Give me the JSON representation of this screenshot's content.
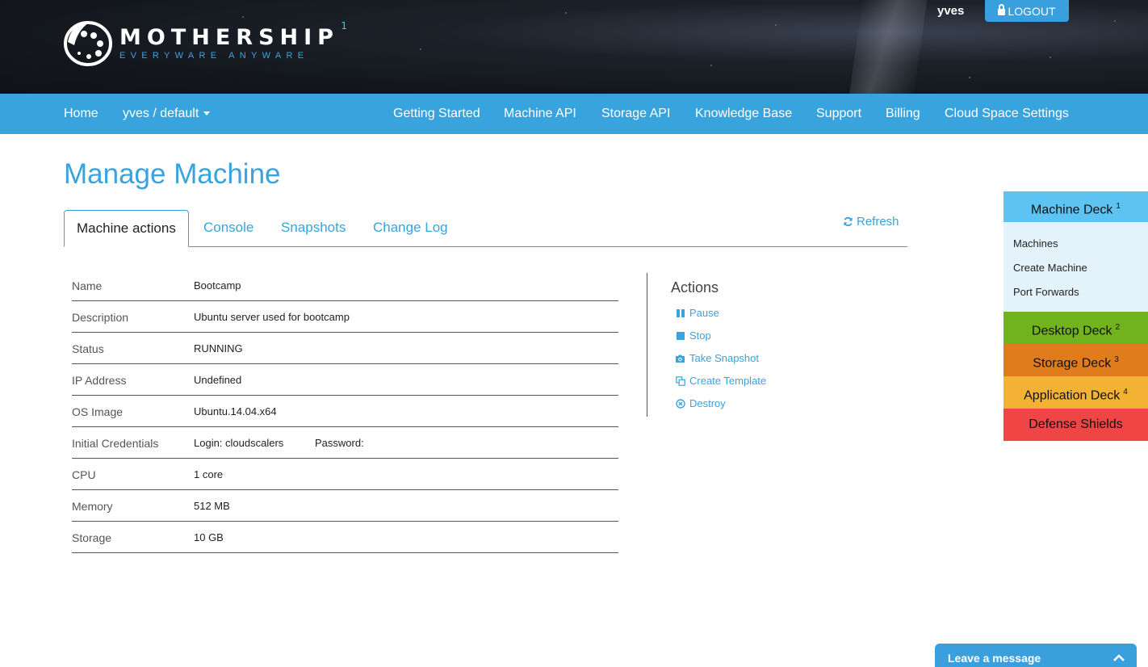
{
  "header": {
    "brand_name": "MOTHERSHIP",
    "brand_sup": "1",
    "brand_tagline": "EVERYWARE ANYWARE",
    "username": "yves",
    "logout_label": "LOGOUT"
  },
  "nav": {
    "home": "Home",
    "space_selector": "yves / default",
    "items": [
      "Getting Started",
      "Machine API",
      "Storage API",
      "Knowledge Base",
      "Support",
      "Billing",
      "Cloud Space Settings"
    ]
  },
  "page": {
    "title": "Manage Machine",
    "tabs": [
      "Machine actions",
      "Console",
      "Snapshots",
      "Change Log"
    ],
    "active_tab": "Machine actions",
    "refresh_label": "Refresh"
  },
  "details": [
    {
      "label": "Name",
      "value": "Bootcamp"
    },
    {
      "label": "Description",
      "value": "Ubuntu server used for bootcamp"
    },
    {
      "label": "Status",
      "value": "RUNNING"
    },
    {
      "label": "IP Address",
      "value": "Undefined"
    },
    {
      "label": "OS Image",
      "value": "Ubuntu.14.04.x64"
    },
    {
      "label": "Initial Credentials",
      "value": "Login: cloudscalers",
      "value2": "Password:"
    },
    {
      "label": "CPU",
      "value": "1 core"
    },
    {
      "label": "Memory",
      "value": "512 MB"
    },
    {
      "label": "Storage",
      "value": "10 GB"
    }
  ],
  "actions": {
    "title": "Actions",
    "items": [
      {
        "label": "Pause",
        "icon": "pause-icon"
      },
      {
        "label": "Stop",
        "icon": "stop-icon"
      },
      {
        "label": "Take Snapshot",
        "icon": "camera-icon"
      },
      {
        "label": "Create Template",
        "icon": "copy-icon"
      },
      {
        "label": "Destroy",
        "icon": "destroy-icon"
      }
    ]
  },
  "decks": {
    "machine": {
      "label": "Machine Deck",
      "num": "1",
      "color": "#5cc3f2"
    },
    "machine_links": [
      "Machines",
      "Create Machine",
      "Port Forwards"
    ],
    "desktop": {
      "label": "Desktop Deck",
      "num": "2",
      "color": "#71b21f"
    },
    "storage": {
      "label": "Storage Deck",
      "num": "3",
      "color": "#df7c1e"
    },
    "application": {
      "label": "Application Deck",
      "num": "4",
      "color": "#f3b234"
    },
    "shields": {
      "label": "Defense Shields",
      "color": "#f04545"
    }
  },
  "chat": {
    "label": "Leave a message"
  },
  "colors": {
    "accent": "#39a3dd",
    "header_bg": "#14181e"
  }
}
